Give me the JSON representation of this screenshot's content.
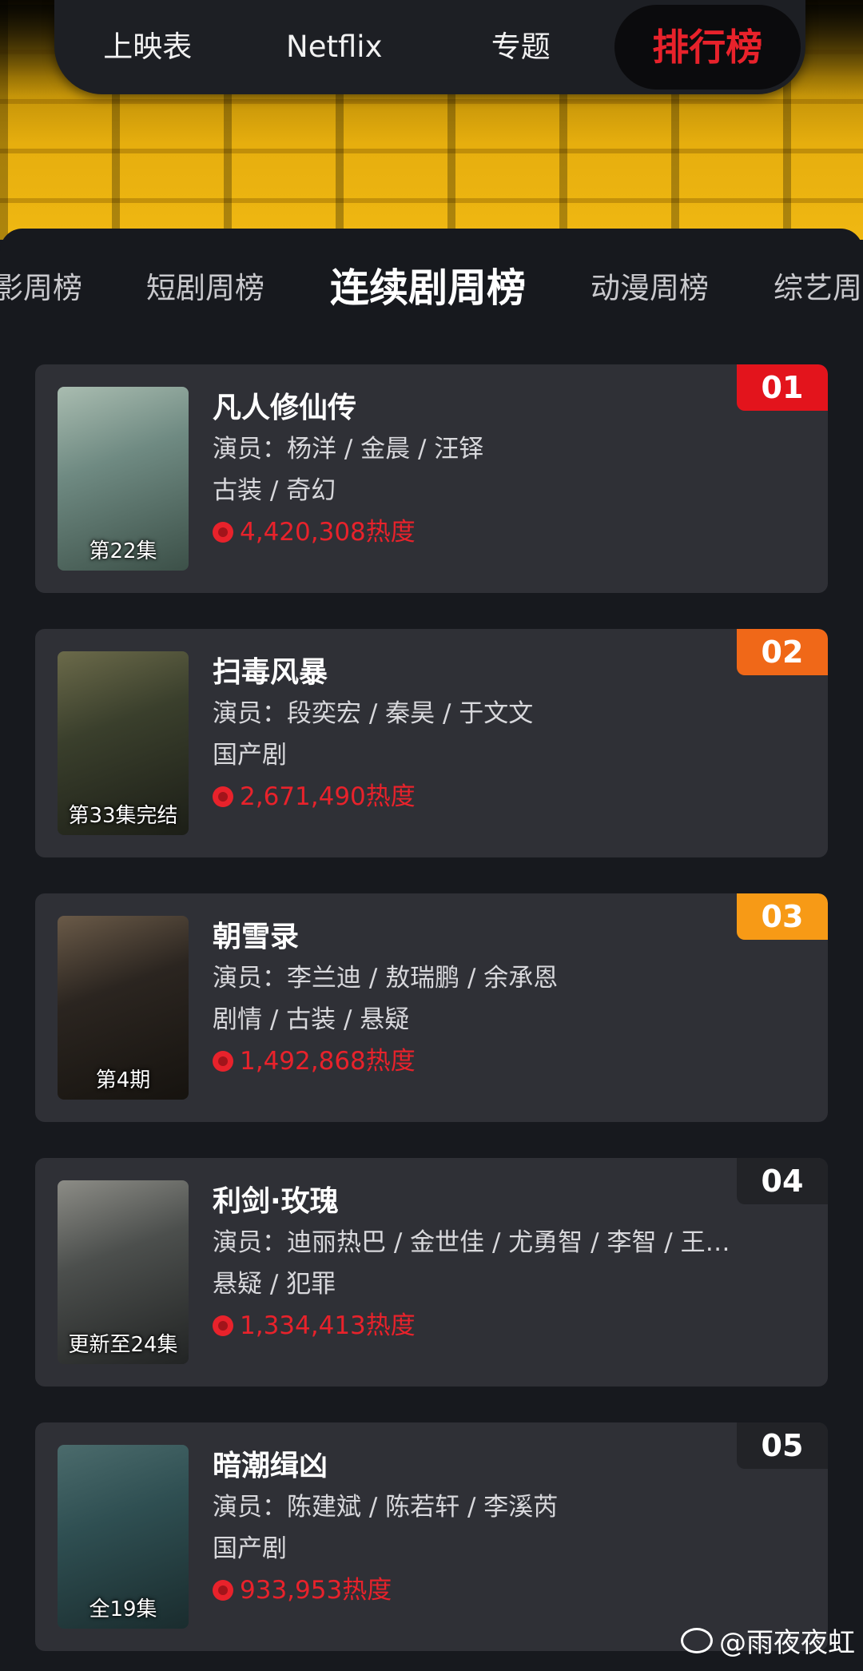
{
  "top_nav": [
    "上映表",
    "Netflix",
    "专题",
    "排行榜"
  ],
  "top_nav_active": "排行榜",
  "sub_tabs": [
    "影周榜",
    "短剧周榜",
    "连续剧周榜",
    "动漫周榜",
    "综艺周"
  ],
  "sub_tab_active": "连续剧周榜",
  "actors_label": "演员：",
  "items": [
    {
      "rank": "01",
      "rank_color": "#e3141c",
      "title": "凡人修仙传",
      "actors": "杨洋 / 金晨 / 汪铎",
      "genres": "古装 / 奇幻",
      "heat": "4,420,308热度",
      "episode": "第22集",
      "poster_colors": [
        "#6f8a82",
        "#3c5048",
        "#a9bcb0"
      ]
    },
    {
      "rank": "02",
      "rank_color": "#f06818",
      "title": "扫毒风暴",
      "actors": "段奕宏 / 秦昊 / 于文文",
      "genres": "国产剧",
      "heat": "2,671,490热度",
      "episode": "第33集完结",
      "poster_colors": [
        "#3a3f2c",
        "#1c1e17",
        "#6b6a4a"
      ]
    },
    {
      "rank": "03",
      "rank_color": "#f79a16",
      "title": "朝雪录",
      "actors": "李兰迪 / 敖瑞鹏 / 余承恩",
      "genres": "剧情 / 古装 / 悬疑",
      "heat": "1,492,868热度",
      "episode": "第4期",
      "poster_colors": [
        "#2b2520",
        "#16130f",
        "#6a5a48"
      ]
    },
    {
      "rank": "04",
      "rank_color": "#222327",
      "title": "利剑·玫瑰",
      "actors": "迪丽热巴 / 金世佳 / 尤勇智 / 李智 / 王…",
      "genres": "悬疑 / 犯罪",
      "heat": "1,334,413热度",
      "episode": "更新至24集",
      "poster_colors": [
        "#4c4f4d",
        "#222424",
        "#8c8c86"
      ]
    },
    {
      "rank": "05",
      "rank_color": "#222327",
      "title": "暗潮缉凶",
      "actors": "陈建斌 / 陈若轩 / 李溪芮",
      "genres": "国产剧",
      "heat": "933,953热度",
      "episode": "全19集",
      "poster_colors": [
        "#2f4f52",
        "#1a2c2e",
        "#4b6b6c"
      ]
    }
  ],
  "watermark": "@雨夜夜虹"
}
